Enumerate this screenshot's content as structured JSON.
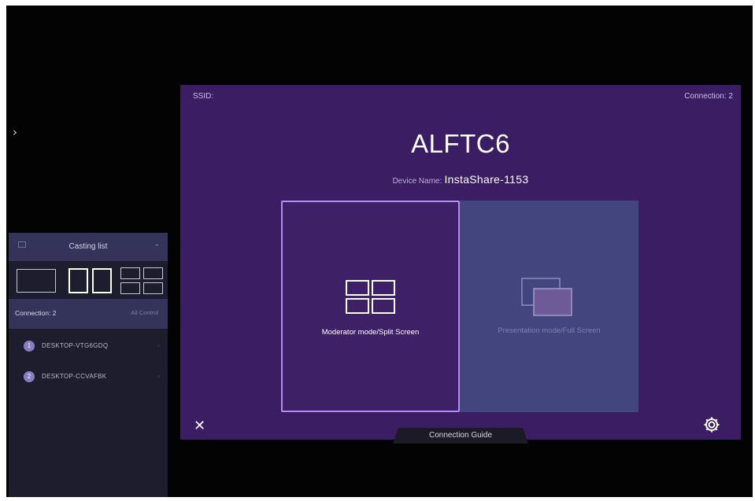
{
  "side_arrow": "›",
  "main": {
    "ssid_label": "SSID:",
    "connection_count": "Connection: 2",
    "title": "ALFTC6",
    "device_name_label": "Device Name:",
    "device_name": "InstaShare-1153",
    "modes": [
      {
        "label": "Moderator mode/Split Screen",
        "icon": "split-screen-icon",
        "selected": true
      },
      {
        "label": "Presentation mode/Full Screen",
        "icon": "full-screen-icon",
        "selected": false
      }
    ],
    "close_glyph": "✕",
    "connection_guide": "Connection Guide",
    "settings_icon": "gear-icon"
  },
  "casting_panel": {
    "title": "Casting list",
    "collapse_glyph": "⌃",
    "layouts": [
      "single-layout-icon",
      "dual-layout-icon",
      "quad-layout-icon"
    ],
    "connection_label": "Connection: 2",
    "all_control_label": "All Control",
    "devices": [
      {
        "number": "1",
        "name": "DESKTOP-VTG6GDQ",
        "status_glyph": "▫"
      },
      {
        "number": "2",
        "name": "DESKTOP-CCVAFBK",
        "status_glyph": "▫"
      }
    ]
  },
  "colors": {
    "main_background": "#3b1d64",
    "selected_border": "#b78cf2",
    "presentation_card": "#43457e",
    "panel_background": "#1d1d2d",
    "panel_header": "#34345a"
  }
}
